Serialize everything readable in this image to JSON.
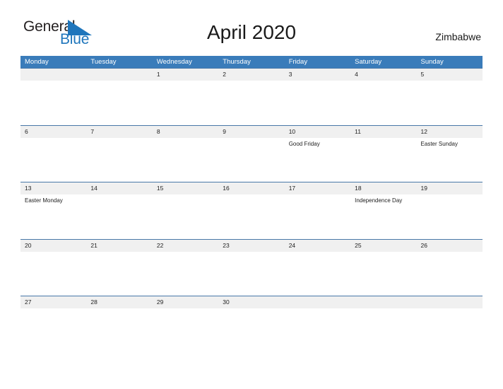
{
  "brand": {
    "name_part1": "General",
    "name_part2": "Blue",
    "triangle_color": "#1f76bc",
    "text_color": "#231f20"
  },
  "header": {
    "title": "April 2020",
    "location": "Zimbabwe"
  },
  "colors": {
    "header_blue": "#3a7cba",
    "row_shade": "#f0f0f0",
    "row_divider": "#4878a8",
    "text": "#222222",
    "page_background": "#ffffff"
  },
  "calendar": {
    "weekdays": [
      "Monday",
      "Tuesday",
      "Wednesday",
      "Thursday",
      "Friday",
      "Saturday",
      "Sunday"
    ],
    "weeks": [
      {
        "dates": [
          "",
          "",
          "1",
          "2",
          "3",
          "4",
          "5"
        ],
        "events": [
          "",
          "",
          "",
          "",
          "",
          "",
          ""
        ]
      },
      {
        "dates": [
          "6",
          "7",
          "8",
          "9",
          "10",
          "11",
          "12"
        ],
        "events": [
          "",
          "",
          "",
          "",
          "Good Friday",
          "",
          "Easter Sunday"
        ]
      },
      {
        "dates": [
          "13",
          "14",
          "15",
          "16",
          "17",
          "18",
          "19"
        ],
        "events": [
          "Easter Monday",
          "",
          "",
          "",
          "",
          "Independence Day",
          ""
        ]
      },
      {
        "dates": [
          "20",
          "21",
          "22",
          "23",
          "24",
          "25",
          "26"
        ],
        "events": [
          "",
          "",
          "",
          "",
          "",
          "",
          ""
        ]
      },
      {
        "dates": [
          "27",
          "28",
          "29",
          "30",
          "",
          "",
          ""
        ],
        "events": [
          "",
          "",
          "",
          "",
          "",
          "",
          ""
        ]
      }
    ]
  }
}
